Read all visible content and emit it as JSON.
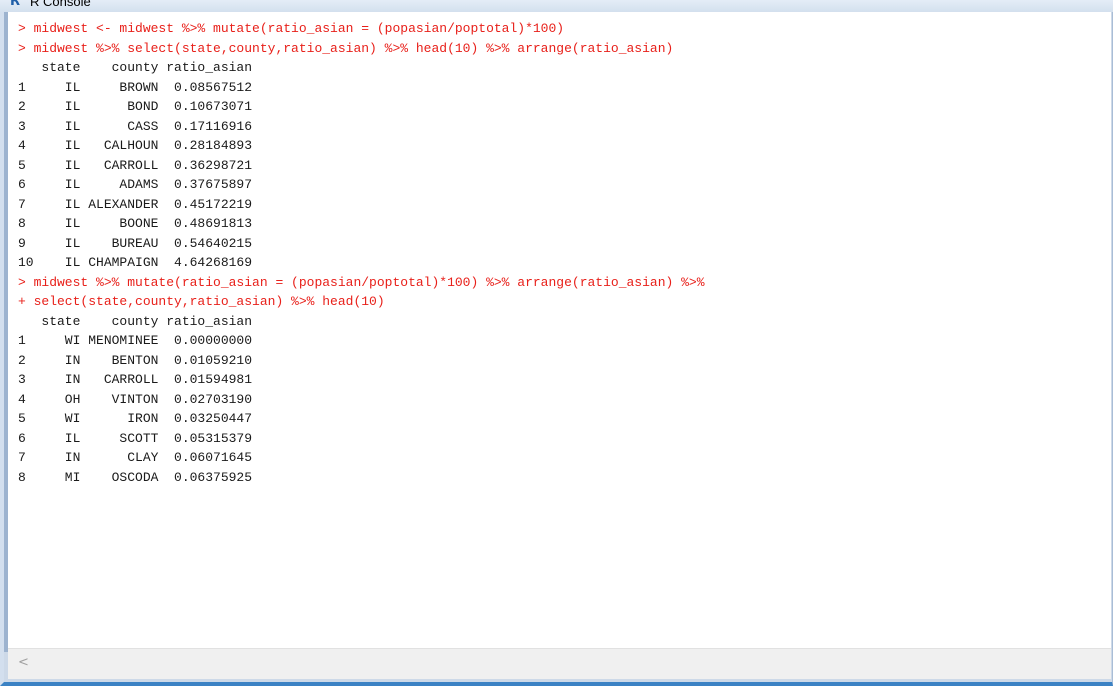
{
  "window": {
    "title": "R Console",
    "icon": "r-logo-icon"
  },
  "console": {
    "lines": [
      {
        "kind": "input",
        "text": "> midwest <- midwest %>% mutate(ratio_asian = (popasian/poptotal)*100)"
      },
      {
        "kind": "input",
        "text": "> midwest %>% select(state,county,ratio_asian) %>% head(10) %>% arrange(ratio_asian)"
      },
      {
        "kind": "output",
        "text": "   state    county ratio_asian"
      },
      {
        "kind": "output",
        "text": "1     IL     BROWN  0.08567512"
      },
      {
        "kind": "output",
        "text": "2     IL      BOND  0.10673071"
      },
      {
        "kind": "output",
        "text": "3     IL      CASS  0.17116916"
      },
      {
        "kind": "output",
        "text": "4     IL   CALHOUN  0.28184893"
      },
      {
        "kind": "output",
        "text": "5     IL   CARROLL  0.36298721"
      },
      {
        "kind": "output",
        "text": "6     IL     ADAMS  0.37675897"
      },
      {
        "kind": "output",
        "text": "7     IL ALEXANDER  0.45172219"
      },
      {
        "kind": "output",
        "text": "8     IL     BOONE  0.48691813"
      },
      {
        "kind": "output",
        "text": "9     IL    BUREAU  0.54640215"
      },
      {
        "kind": "output",
        "text": "10    IL CHAMPAIGN  4.64268169"
      },
      {
        "kind": "input",
        "text": "> midwest %>% mutate(ratio_asian = (popasian/poptotal)*100) %>% arrange(ratio_asian) %>%"
      },
      {
        "kind": "input",
        "text": "+ select(state,county,ratio_asian) %>% head(10)"
      },
      {
        "kind": "output",
        "text": "   state    county ratio_asian"
      },
      {
        "kind": "output",
        "text": "1     WI MENOMINEE  0.00000000"
      },
      {
        "kind": "output",
        "text": "2     IN    BENTON  0.01059210"
      },
      {
        "kind": "output",
        "text": "3     IN   CARROLL  0.01594981"
      },
      {
        "kind": "output",
        "text": "4     OH    VINTON  0.02703190"
      },
      {
        "kind": "output",
        "text": "5     WI      IRON  0.03250447"
      },
      {
        "kind": "output",
        "text": "6     IL     SCOTT  0.05315379"
      },
      {
        "kind": "output",
        "text": "7     IN      CLAY  0.06071645"
      },
      {
        "kind": "output",
        "text": "8     MI    OSCODA  0.06375925"
      }
    ]
  },
  "scrollbar": {
    "left_arrow": "<",
    "left_arrow_icon": "chevron-left-icon"
  },
  "colors": {
    "input_text": "#e8201a",
    "output_text": "#1a1a1a"
  }
}
